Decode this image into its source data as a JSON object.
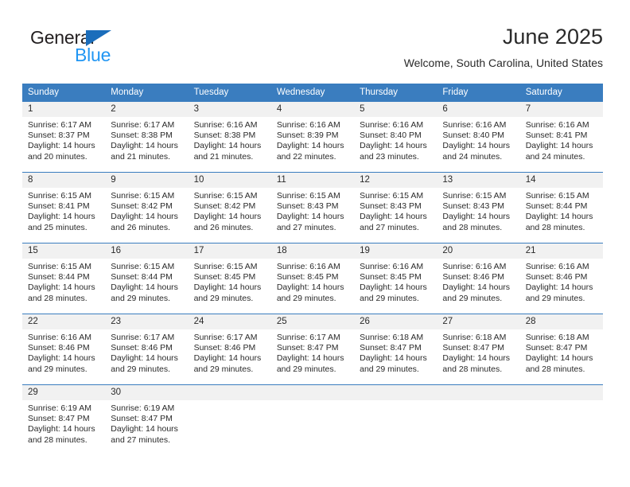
{
  "branding": {
    "logo_line1": "General",
    "logo_line2": "Blue",
    "accent_blue": "#2196f3",
    "logo_triangle_color": "#1a6dbb"
  },
  "header": {
    "title": "June 2025",
    "subtitle": "Welcome, South Carolina, United States",
    "header_row_color": "#3a7dbf"
  },
  "calendar": {
    "weekday_headers": [
      "Sunday",
      "Monday",
      "Tuesday",
      "Wednesday",
      "Thursday",
      "Friday",
      "Saturday"
    ],
    "weeks": [
      [
        {
          "day": "1",
          "sunrise": "Sunrise: 6:17 AM",
          "sunset": "Sunset: 8:37 PM",
          "daylight1": "Daylight: 14 hours",
          "daylight2": "and 20 minutes."
        },
        {
          "day": "2",
          "sunrise": "Sunrise: 6:17 AM",
          "sunset": "Sunset: 8:38 PM",
          "daylight1": "Daylight: 14 hours",
          "daylight2": "and 21 minutes."
        },
        {
          "day": "3",
          "sunrise": "Sunrise: 6:16 AM",
          "sunset": "Sunset: 8:38 PM",
          "daylight1": "Daylight: 14 hours",
          "daylight2": "and 21 minutes."
        },
        {
          "day": "4",
          "sunrise": "Sunrise: 6:16 AM",
          "sunset": "Sunset: 8:39 PM",
          "daylight1": "Daylight: 14 hours",
          "daylight2": "and 22 minutes."
        },
        {
          "day": "5",
          "sunrise": "Sunrise: 6:16 AM",
          "sunset": "Sunset: 8:40 PM",
          "daylight1": "Daylight: 14 hours",
          "daylight2": "and 23 minutes."
        },
        {
          "day": "6",
          "sunrise": "Sunrise: 6:16 AM",
          "sunset": "Sunset: 8:40 PM",
          "daylight1": "Daylight: 14 hours",
          "daylight2": "and 24 minutes."
        },
        {
          "day": "7",
          "sunrise": "Sunrise: 6:16 AM",
          "sunset": "Sunset: 8:41 PM",
          "daylight1": "Daylight: 14 hours",
          "daylight2": "and 24 minutes."
        }
      ],
      [
        {
          "day": "8",
          "sunrise": "Sunrise: 6:15 AM",
          "sunset": "Sunset: 8:41 PM",
          "daylight1": "Daylight: 14 hours",
          "daylight2": "and 25 minutes."
        },
        {
          "day": "9",
          "sunrise": "Sunrise: 6:15 AM",
          "sunset": "Sunset: 8:42 PM",
          "daylight1": "Daylight: 14 hours",
          "daylight2": "and 26 minutes."
        },
        {
          "day": "10",
          "sunrise": "Sunrise: 6:15 AM",
          "sunset": "Sunset: 8:42 PM",
          "daylight1": "Daylight: 14 hours",
          "daylight2": "and 26 minutes."
        },
        {
          "day": "11",
          "sunrise": "Sunrise: 6:15 AM",
          "sunset": "Sunset: 8:43 PM",
          "daylight1": "Daylight: 14 hours",
          "daylight2": "and 27 minutes."
        },
        {
          "day": "12",
          "sunrise": "Sunrise: 6:15 AM",
          "sunset": "Sunset: 8:43 PM",
          "daylight1": "Daylight: 14 hours",
          "daylight2": "and 27 minutes."
        },
        {
          "day": "13",
          "sunrise": "Sunrise: 6:15 AM",
          "sunset": "Sunset: 8:43 PM",
          "daylight1": "Daylight: 14 hours",
          "daylight2": "and 28 minutes."
        },
        {
          "day": "14",
          "sunrise": "Sunrise: 6:15 AM",
          "sunset": "Sunset: 8:44 PM",
          "daylight1": "Daylight: 14 hours",
          "daylight2": "and 28 minutes."
        }
      ],
      [
        {
          "day": "15",
          "sunrise": "Sunrise: 6:15 AM",
          "sunset": "Sunset: 8:44 PM",
          "daylight1": "Daylight: 14 hours",
          "daylight2": "and 28 minutes."
        },
        {
          "day": "16",
          "sunrise": "Sunrise: 6:15 AM",
          "sunset": "Sunset: 8:44 PM",
          "daylight1": "Daylight: 14 hours",
          "daylight2": "and 29 minutes."
        },
        {
          "day": "17",
          "sunrise": "Sunrise: 6:15 AM",
          "sunset": "Sunset: 8:45 PM",
          "daylight1": "Daylight: 14 hours",
          "daylight2": "and 29 minutes."
        },
        {
          "day": "18",
          "sunrise": "Sunrise: 6:16 AM",
          "sunset": "Sunset: 8:45 PM",
          "daylight1": "Daylight: 14 hours",
          "daylight2": "and 29 minutes."
        },
        {
          "day": "19",
          "sunrise": "Sunrise: 6:16 AM",
          "sunset": "Sunset: 8:45 PM",
          "daylight1": "Daylight: 14 hours",
          "daylight2": "and 29 minutes."
        },
        {
          "day": "20",
          "sunrise": "Sunrise: 6:16 AM",
          "sunset": "Sunset: 8:46 PM",
          "daylight1": "Daylight: 14 hours",
          "daylight2": "and 29 minutes."
        },
        {
          "day": "21",
          "sunrise": "Sunrise: 6:16 AM",
          "sunset": "Sunset: 8:46 PM",
          "daylight1": "Daylight: 14 hours",
          "daylight2": "and 29 minutes."
        }
      ],
      [
        {
          "day": "22",
          "sunrise": "Sunrise: 6:16 AM",
          "sunset": "Sunset: 8:46 PM",
          "daylight1": "Daylight: 14 hours",
          "daylight2": "and 29 minutes."
        },
        {
          "day": "23",
          "sunrise": "Sunrise: 6:17 AM",
          "sunset": "Sunset: 8:46 PM",
          "daylight1": "Daylight: 14 hours",
          "daylight2": "and 29 minutes."
        },
        {
          "day": "24",
          "sunrise": "Sunrise: 6:17 AM",
          "sunset": "Sunset: 8:46 PM",
          "daylight1": "Daylight: 14 hours",
          "daylight2": "and 29 minutes."
        },
        {
          "day": "25",
          "sunrise": "Sunrise: 6:17 AM",
          "sunset": "Sunset: 8:47 PM",
          "daylight1": "Daylight: 14 hours",
          "daylight2": "and 29 minutes."
        },
        {
          "day": "26",
          "sunrise": "Sunrise: 6:18 AM",
          "sunset": "Sunset: 8:47 PM",
          "daylight1": "Daylight: 14 hours",
          "daylight2": "and 29 minutes."
        },
        {
          "day": "27",
          "sunrise": "Sunrise: 6:18 AM",
          "sunset": "Sunset: 8:47 PM",
          "daylight1": "Daylight: 14 hours",
          "daylight2": "and 28 minutes."
        },
        {
          "day": "28",
          "sunrise": "Sunrise: 6:18 AM",
          "sunset": "Sunset: 8:47 PM",
          "daylight1": "Daylight: 14 hours",
          "daylight2": "and 28 minutes."
        }
      ],
      [
        {
          "day": "29",
          "sunrise": "Sunrise: 6:19 AM",
          "sunset": "Sunset: 8:47 PM",
          "daylight1": "Daylight: 14 hours",
          "daylight2": "and 28 minutes."
        },
        {
          "day": "30",
          "sunrise": "Sunrise: 6:19 AM",
          "sunset": "Sunset: 8:47 PM",
          "daylight1": "Daylight: 14 hours",
          "daylight2": "and 27 minutes."
        },
        {
          "day": "",
          "sunrise": "",
          "sunset": "",
          "daylight1": "",
          "daylight2": ""
        },
        {
          "day": "",
          "sunrise": "",
          "sunset": "",
          "daylight1": "",
          "daylight2": ""
        },
        {
          "day": "",
          "sunrise": "",
          "sunset": "",
          "daylight1": "",
          "daylight2": ""
        },
        {
          "day": "",
          "sunrise": "",
          "sunset": "",
          "daylight1": "",
          "daylight2": ""
        },
        {
          "day": "",
          "sunrise": "",
          "sunset": "",
          "daylight1": "",
          "daylight2": ""
        }
      ]
    ]
  }
}
